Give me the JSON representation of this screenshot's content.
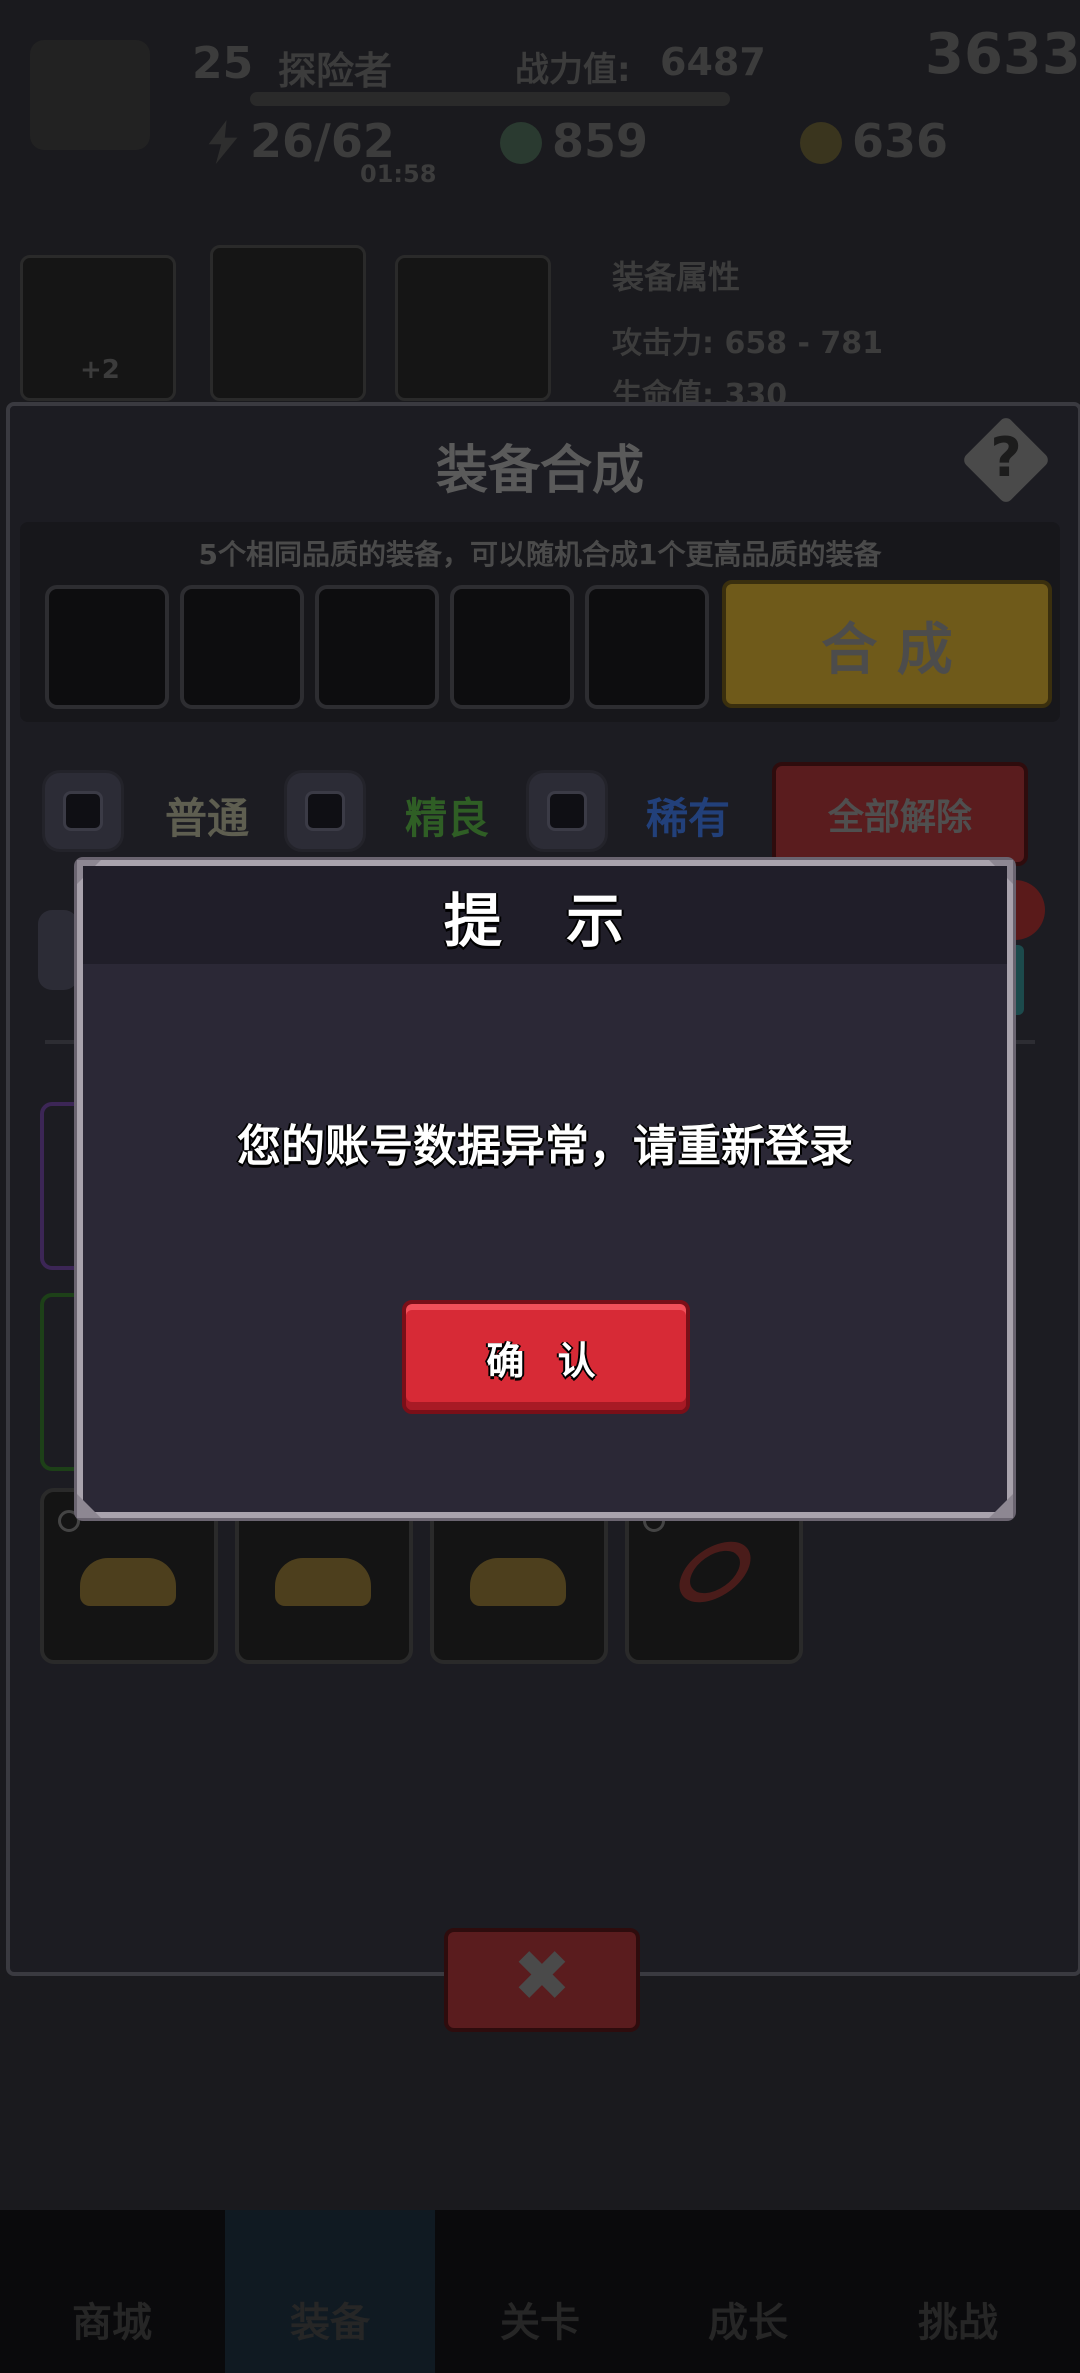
{
  "top_bar": {
    "level": "25",
    "rank": "探险者",
    "power_label": "战力值:",
    "power_value": "6487",
    "gold_big": "3633",
    "stamina": "26/62",
    "timer": "01:58",
    "gems": "859",
    "coins": "636"
  },
  "hero_card": {
    "name": "装备属性",
    "attack": "攻击力: 658 - 781",
    "hp": "生命值: 330",
    "badge": "+2"
  },
  "synth_panel": {
    "title": "装备合成",
    "help_icon": "question-icon",
    "hint": "5个相同品质的装备，可以随机合成1个更高品质的装备",
    "synth_button": "合 成",
    "quality_filters": [
      {
        "label": "普通",
        "color": "#6b6b58"
      },
      {
        "label": "精良",
        "color": "#2f6b25"
      },
      {
        "label": "稀有",
        "color": "#22407a"
      }
    ],
    "clear_all_button": "全部解除",
    "close_icon": "close-icon"
  },
  "bottom_nav": [
    "商城",
    "装备",
    "关卡",
    "成长",
    "挑战"
  ],
  "dialog": {
    "title": "提 示",
    "message": "您的账号数据异常，请重新登录",
    "confirm_label": "确 认",
    "colors": {
      "confirm": "#d72a36",
      "frame": "#a9a3ad",
      "body": "#2b2836"
    }
  }
}
